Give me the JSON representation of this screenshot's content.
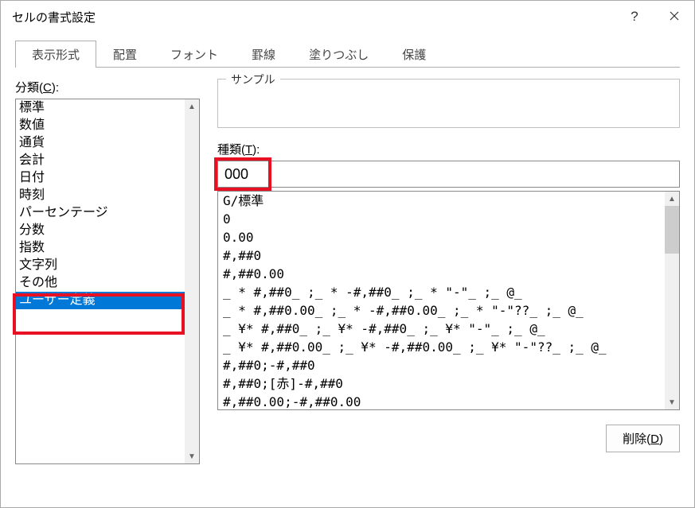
{
  "window": {
    "title": "セルの書式設定"
  },
  "titlebar_buttons": {
    "help_label": "?",
    "close_label": "✕"
  },
  "tabs": [
    {
      "label": "表示形式"
    },
    {
      "label": "配置"
    },
    {
      "label": "フォント"
    },
    {
      "label": "罫線"
    },
    {
      "label": "塗りつぶし"
    },
    {
      "label": "保護"
    }
  ],
  "left": {
    "category_label_prefix": "分類(",
    "category_label_key": "C",
    "category_label_suffix": "):",
    "categories": [
      "標準",
      "数値",
      "通貨",
      "会計",
      "日付",
      "時刻",
      "パーセンテージ",
      "分数",
      "指数",
      "文字列",
      "その他",
      "ユーザー定義"
    ],
    "selected_index": 11
  },
  "right": {
    "sample_label": "サンプル",
    "type_label_prefix": "種類(",
    "type_label_key": "T",
    "type_label_suffix": "):",
    "type_value": "000",
    "type_list": [
      "G/標準",
      "0",
      "0.00",
      "#,##0",
      "#,##0.00",
      "_ * #,##0_ ;_ * -#,##0_ ;_ * \"-\"_ ;_ @_",
      "_ * #,##0.00_ ;_ * -#,##0.00_ ;_ * \"-\"??_ ;_ @_",
      "_ ¥* #,##0_ ;_ ¥* -#,##0_ ;_ ¥* \"-\"_ ;_ @_",
      "_ ¥* #,##0.00_ ;_ ¥* -#,##0.00_ ;_ ¥* \"-\"??_ ;_ @_",
      "#,##0;-#,##0",
      "#,##0;[赤]-#,##0",
      "#,##0.00;-#,##0.00"
    ],
    "delete_label_prefix": "削除(",
    "delete_label_key": "D",
    "delete_label_suffix": ")"
  }
}
